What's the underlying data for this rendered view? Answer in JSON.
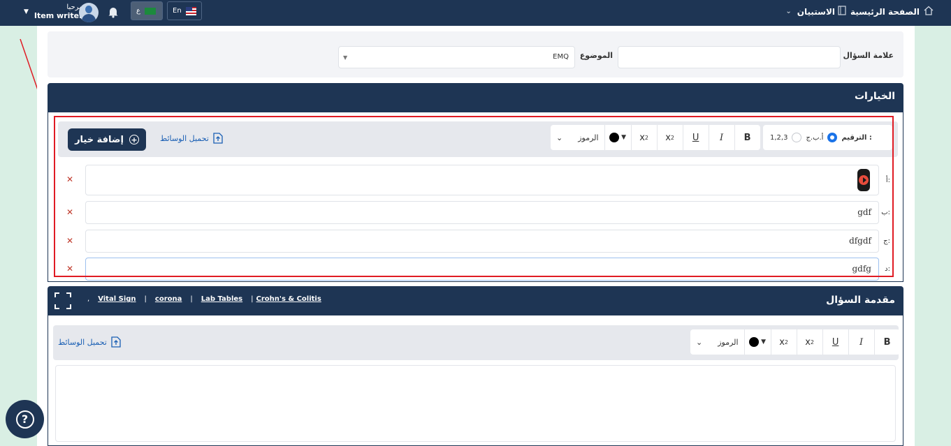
{
  "topbar": {
    "home_label": "الصفحة الرئيسية",
    "survey_label": "الاستبيان",
    "user_greeting": "مرحبا",
    "user_role": "Item writer",
    "lang_ar_label": "ع",
    "lang_en_label": "En"
  },
  "question_meta": {
    "tag_label": "علامة السؤال",
    "tag_value": "",
    "topic_label": "الموضوع",
    "topic_value": "EMQ"
  },
  "options_panel": {
    "title": "الخيارات",
    "numbering_label": "الترقيم :",
    "numbering_options": [
      "أ.ب.ج",
      "1,2,3"
    ],
    "numbering_selected": "أ.ب.ج",
    "symbols_label": "الرموز",
    "upload_label": "تحميل الوسائط",
    "add_option_label": "إضافة خيار",
    "options": [
      {
        "letter": "أ:",
        "text": "",
        "media": "video"
      },
      {
        "letter": "ب:",
        "text": "gdf"
      },
      {
        "letter": "ج:",
        "text": "dfgdf"
      },
      {
        "letter": "د:",
        "text": "gdfg"
      }
    ]
  },
  "intro_panel": {
    "title": "مقدمة السؤال",
    "links": [
      "Vital Sign",
      "corona",
      "Lab Tables",
      "Crohn's & Colitis"
    ],
    "symbols_label": "الرموز",
    "upload_label": "تحميل الوسائط"
  },
  "colors": {
    "navy": "#1e3554",
    "annotation_red": "#e01b24",
    "link_blue": "#1a5fb4"
  }
}
